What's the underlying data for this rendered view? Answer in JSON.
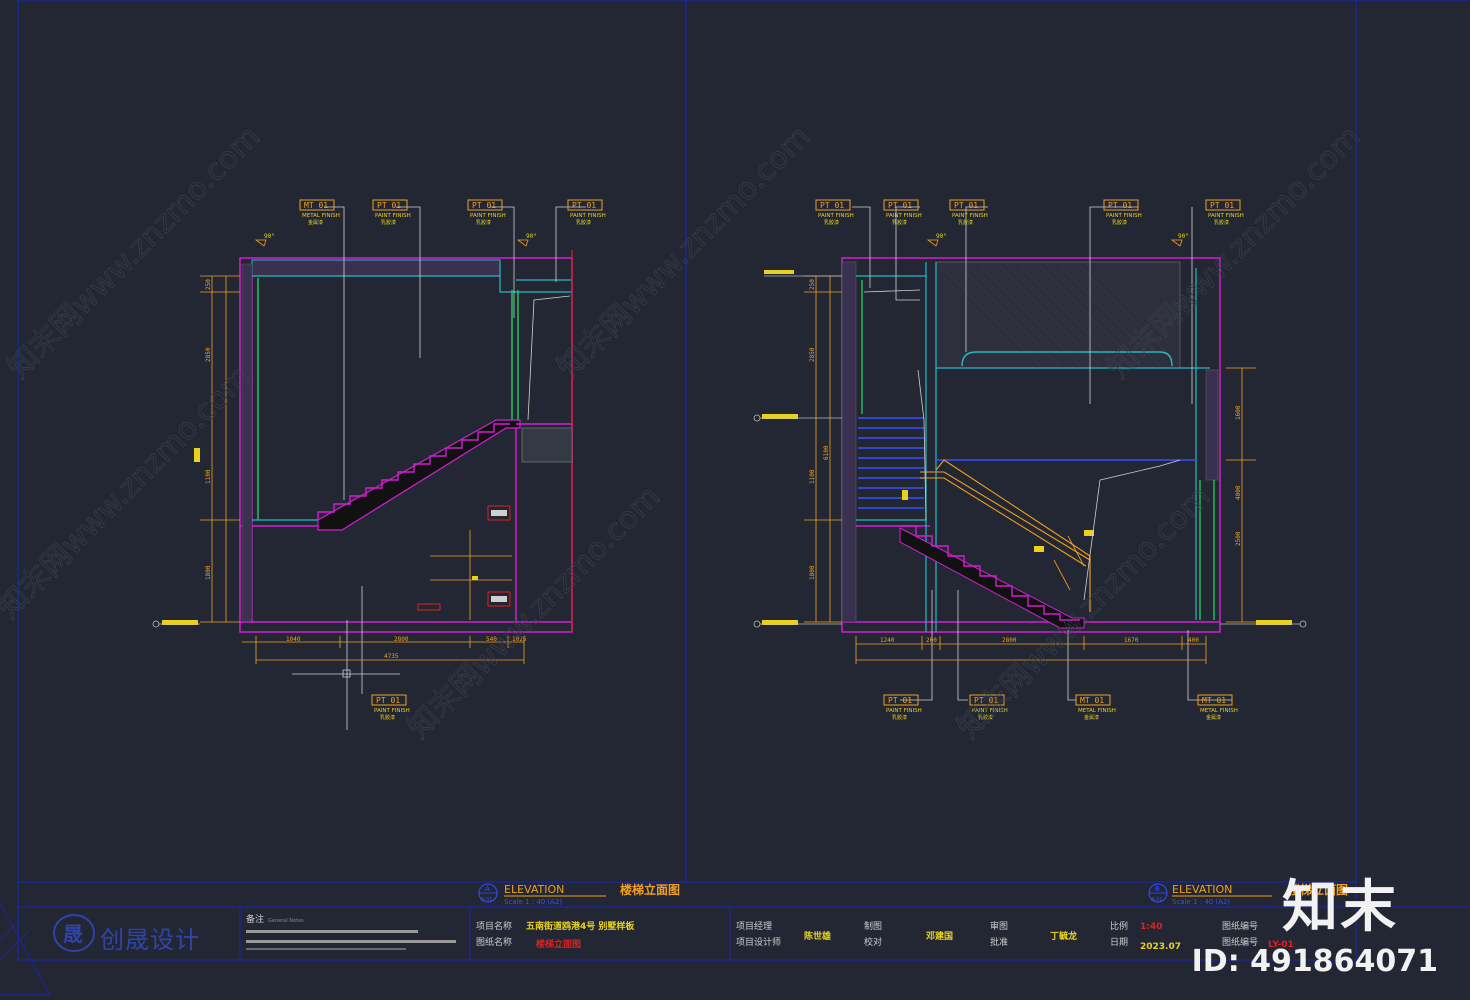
{
  "colors": {
    "background": "#222733",
    "frame_blue": "#1b25a8",
    "magenta": "#d21ed2",
    "cyan": "#25b8c8",
    "green": "#22d060",
    "orange": "#f0a020",
    "yellow": "#e8d21e",
    "red": "#e02020",
    "white": "#d8d8d8"
  },
  "left_view": {
    "tags": [
      {
        "code": "MT 01",
        "line2": "METAL FINISH",
        "line3": "金属漆"
      },
      {
        "code": "PT 01",
        "line2": "PAINT FINISH",
        "line3": "乳胶漆"
      },
      {
        "code": "PT 01",
        "line2": "PAINT FINISH",
        "line3": "乳胶漆"
      },
      {
        "code": "PT 01",
        "line2": "PAINT FINISH",
        "line3": "乳胶漆"
      }
    ],
    "bottom_tag": {
      "code": "PT 01",
      "line2": "PAINT FINISH",
      "line3": "乳胶漆"
    },
    "dim_bottom": [
      "1040",
      "2800",
      "540",
      "1025"
    ],
    "dim_total": "4735",
    "dim_vertical": [
      "250",
      "2850",
      "1100",
      "1800"
    ]
  },
  "right_view": {
    "tags": [
      {
        "code": "PT 01",
        "line2": "PAINT FINISH",
        "line3": "乳胶漆"
      },
      {
        "code": "PT 01",
        "line2": "PAINT FINISH",
        "line3": "乳胶漆"
      },
      {
        "code": "PT 01",
        "line2": "PAINT FINISH",
        "line3": "乳胶漆"
      },
      {
        "code": "PT 01",
        "line2": "PAINT FINISH",
        "line3": "乳胶漆"
      },
      {
        "code": "PT 01",
        "line2": "PAINT FINISH",
        "line3": "乳胶漆"
      }
    ],
    "bottom_tags": [
      {
        "code": "PT 01",
        "line2": "PAINT FINISH",
        "line3": "乳胶漆"
      },
      {
        "code": "PT 01",
        "line2": "PAINT FINISH",
        "line3": "乳胶漆"
      },
      {
        "code": "MT 01",
        "line2": "METAL FINISH",
        "line3": "金属漆"
      },
      {
        "code": "MT 01",
        "line2": "METAL FINISH",
        "line3": "金属漆"
      }
    ],
    "dim_bottom": [
      "1240",
      "200",
      "2800",
      "1670",
      "400"
    ],
    "dim_vertical": [
      "250",
      "2850",
      "6100",
      "1100",
      "1800"
    ],
    "dim_vertical_right": [
      "1600",
      "4000",
      "2500"
    ]
  },
  "title_left": {
    "letter": "A",
    "sheet": "A-01",
    "heading": "ELEVATION",
    "scale": "Scale 1 : 40 (A2)",
    "cn": "楼梯立面图"
  },
  "title_right": {
    "letter": "B",
    "sheet": "A-01",
    "heading": "ELEVATION",
    "scale": "Scale 1 : 40 (A2)",
    "cn": "楼梯立面图"
  },
  "title_block": {
    "company": "创晟设计",
    "notes_label": "备注",
    "notes_label_en": "General Notes",
    "project_name_label": "项目名称",
    "project_name": "五南街道鸥港4号 别墅样板",
    "drawing_name_label": "图纸名称",
    "drawing_name": "楼梯立面图",
    "owner_label": "项目经理",
    "designer_label": "项目设计师",
    "designer": "陈世雄",
    "draft_label": "制图",
    "check_label": "校对",
    "checker": "邓建国",
    "review_label": "审图",
    "approve_label": "批准",
    "approver": "丁毓龙",
    "scale_label": "比例",
    "scale": "1:40",
    "date_label": "日期",
    "date": "2023.07",
    "drawing_no_label": "图纸编号",
    "drawing_no": "LY-01"
  },
  "watermark": {
    "brand": "知末",
    "id": "ID: 491864071",
    "site": "知末网www.znzmo.com"
  }
}
